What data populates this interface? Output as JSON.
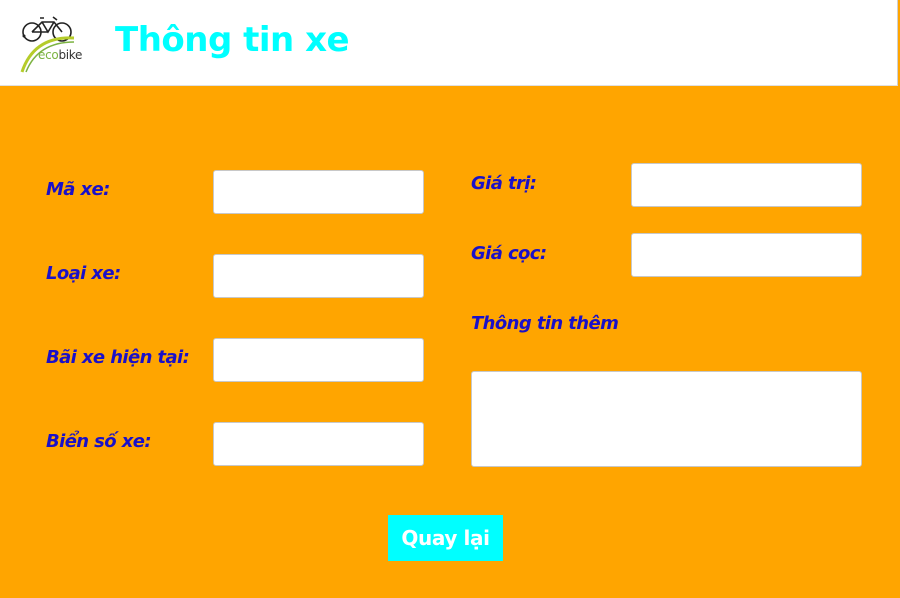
{
  "header": {
    "logo_text_eco": "eco",
    "logo_text_bike": "bike",
    "title": "Thông tin xe"
  },
  "form": {
    "bike_id_label": "Mã xe:",
    "bike_id_value": "",
    "bike_type_label": "Loại xe:",
    "bike_type_value": "",
    "current_station_label": "Bãi xe hiện tại:",
    "current_station_value": "",
    "license_plate_label": "Biển số xe:",
    "license_plate_value": "",
    "value_label": "Giá trị:",
    "value_value": "",
    "deposit_label": "Giá cọc:",
    "deposit_value": "",
    "extra_info_label": "Thông tin thêm",
    "extra_info_value": ""
  },
  "actions": {
    "back_label": "Quay lại"
  },
  "colors": {
    "background": "#ffa500",
    "title": "#00ffff",
    "label": "#1a10c8",
    "button": "#00ffff"
  }
}
